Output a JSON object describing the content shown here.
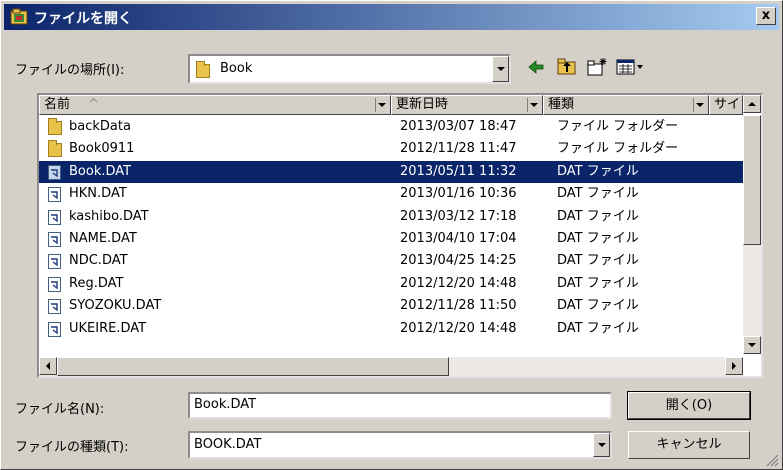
{
  "window": {
    "title": "ファイルを開く",
    "close_label": "x"
  },
  "location": {
    "label": "ファイルの場所(I):",
    "value": "Book"
  },
  "toolbar": {
    "icons": [
      "back-icon",
      "up-folder-icon",
      "new-folder-icon",
      "view-menu-icon"
    ]
  },
  "columns": [
    "名前",
    "更新日時",
    "種類",
    "サイ"
  ],
  "sort_indicator": "^",
  "files": [
    {
      "name": "backData",
      "date": "2013/03/07 18:47",
      "type": "ファイル フォルダー",
      "kind": "folder"
    },
    {
      "name": "Book0911",
      "date": "2012/11/28 11:47",
      "type": "ファイル フォルダー",
      "kind": "folder"
    },
    {
      "name": "Book.DAT",
      "date": "2013/05/11 11:32",
      "type": "DAT ファイル",
      "kind": "file",
      "selected": true
    },
    {
      "name": "HKN.DAT",
      "date": "2013/01/16 10:36",
      "type": "DAT ファイル",
      "kind": "file"
    },
    {
      "name": "kashibo.DAT",
      "date": "2013/03/12 17:18",
      "type": "DAT ファイル",
      "kind": "file"
    },
    {
      "name": "NAME.DAT",
      "date": "2013/04/10 17:04",
      "type": "DAT ファイル",
      "kind": "file"
    },
    {
      "name": "NDC.DAT",
      "date": "2013/04/25 14:25",
      "type": "DAT ファイル",
      "kind": "file"
    },
    {
      "name": "Reg.DAT",
      "date": "2012/12/20 14:48",
      "type": "DAT ファイル",
      "kind": "file"
    },
    {
      "name": "SYOZOKU.DAT",
      "date": "2012/11/28 11:50",
      "type": "DAT ファイル",
      "kind": "file"
    },
    {
      "name": "UKEIRE.DAT",
      "date": "2012/12/20 14:48",
      "type": "DAT ファイル",
      "kind": "file"
    }
  ],
  "filename": {
    "label": "ファイル名(N):",
    "value": "Book.DAT"
  },
  "filetype": {
    "label": "ファイルの種類(T):",
    "value": "BOOK.DAT"
  },
  "buttons": {
    "open": "開く(O)",
    "cancel": "キャンセル"
  },
  "colors": {
    "titlebar_start": "#0a246a",
    "titlebar_end": "#a6caf0",
    "selection": "#0a246a",
    "face": "#d4d0c8"
  }
}
